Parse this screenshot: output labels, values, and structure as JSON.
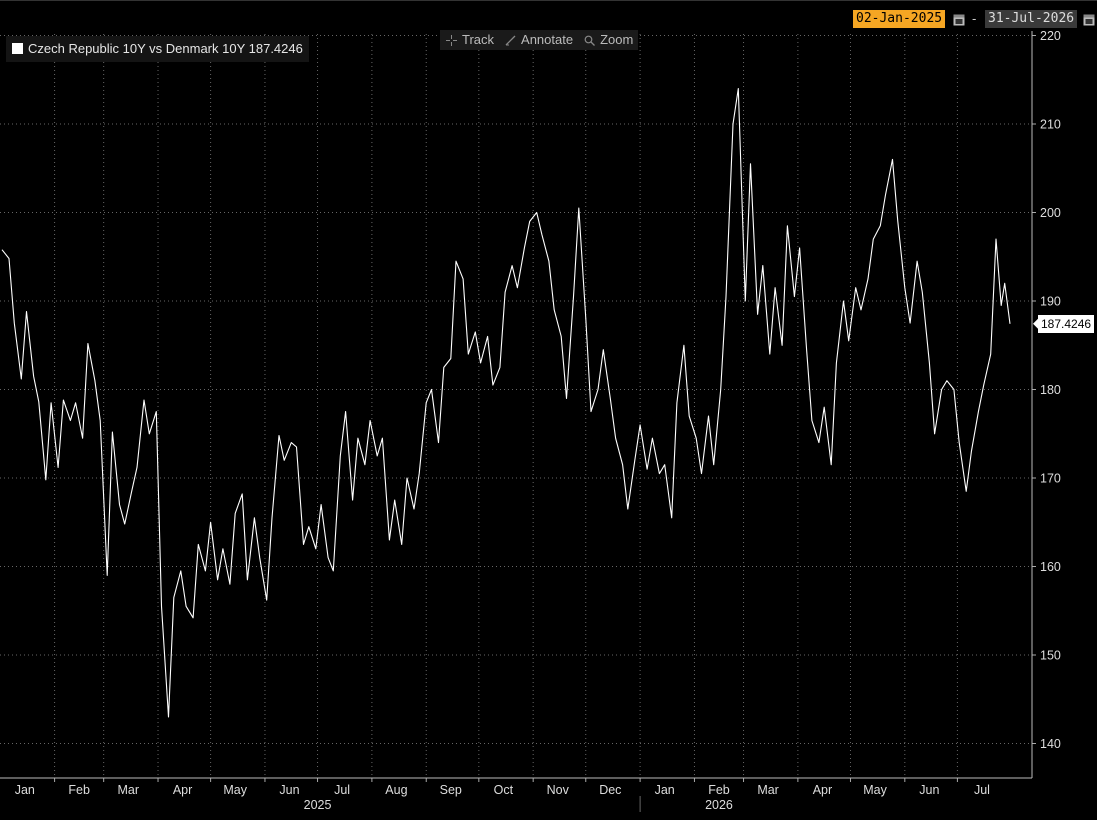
{
  "header": {
    "start_date": "02-Jan-2025",
    "separator": "-",
    "end_date": "31-Jul-2026",
    "calendar_icon": "calendar-icon"
  },
  "toolbar": {
    "track_label": "Track",
    "annotate_label": "Annotate",
    "zoom_label": "Zoom",
    "track_icon": "crosshair-icon",
    "annotate_icon": "pencil-icon",
    "zoom_icon": "magnifier-icon"
  },
  "legend": {
    "text": "Czech Republic 10Y vs Denmark 10Y 187.4246"
  },
  "last_value_label": "187.4246",
  "colors": {
    "background": "#000000",
    "line": "#ffffff",
    "start_date_highlight": "#f5a623",
    "end_date_bg": "#3a3a3a",
    "grid": "#666666"
  },
  "chart_data": {
    "type": "line",
    "series": [
      {
        "name": "Czech Republic 10Y vs Denmark 10Y",
        "points": [
          [
            "2025-01-02",
            195.8
          ],
          [
            "2025-01-06",
            194.8
          ],
          [
            "2025-01-09",
            187.5
          ],
          [
            "2025-01-13",
            181.2
          ],
          [
            "2025-01-16",
            188.8
          ],
          [
            "2025-01-20",
            181.5
          ],
          [
            "2025-01-23",
            178.6
          ],
          [
            "2025-01-27",
            169.8
          ],
          [
            "2025-01-30",
            178.5
          ],
          [
            "2025-02-03",
            171.2
          ],
          [
            "2025-02-06",
            178.8
          ],
          [
            "2025-02-10",
            176.5
          ],
          [
            "2025-02-13",
            178.5
          ],
          [
            "2025-02-17",
            174.5
          ],
          [
            "2025-02-20",
            185.2
          ],
          [
            "2025-02-24",
            181.0
          ],
          [
            "2025-02-27",
            176.5
          ],
          [
            "2025-03-03",
            159.0
          ],
          [
            "2025-03-06",
            175.2
          ],
          [
            "2025-03-10",
            167.0
          ],
          [
            "2025-03-13",
            164.8
          ],
          [
            "2025-03-17",
            168.5
          ],
          [
            "2025-03-20",
            171.2
          ],
          [
            "2025-03-24",
            178.8
          ],
          [
            "2025-03-27",
            175.0
          ],
          [
            "2025-03-31",
            177.5
          ],
          [
            "2025-04-03",
            155.5
          ],
          [
            "2025-04-07",
            143.0
          ],
          [
            "2025-04-10",
            156.5
          ],
          [
            "2025-04-14",
            159.5
          ],
          [
            "2025-04-17",
            155.5
          ],
          [
            "2025-04-21",
            154.2
          ],
          [
            "2025-04-24",
            162.5
          ],
          [
            "2025-04-28",
            159.5
          ],
          [
            "2025-05-01",
            165.0
          ],
          [
            "2025-05-05",
            158.5
          ],
          [
            "2025-05-08",
            162.0
          ],
          [
            "2025-05-12",
            158.0
          ],
          [
            "2025-05-15",
            166.0
          ],
          [
            "2025-05-19",
            168.2
          ],
          [
            "2025-05-22",
            158.5
          ],
          [
            "2025-05-26",
            165.5
          ],
          [
            "2025-05-29",
            161.0
          ],
          [
            "2025-06-02",
            156.2
          ],
          [
            "2025-06-05",
            165.5
          ],
          [
            "2025-06-09",
            174.8
          ],
          [
            "2025-06-12",
            172.0
          ],
          [
            "2025-06-16",
            174.0
          ],
          [
            "2025-06-19",
            173.5
          ],
          [
            "2025-06-23",
            162.5
          ],
          [
            "2025-06-26",
            164.5
          ],
          [
            "2025-06-30",
            162.0
          ],
          [
            "2025-07-03",
            167.0
          ],
          [
            "2025-07-07",
            161.0
          ],
          [
            "2025-07-10",
            159.5
          ],
          [
            "2025-07-14",
            172.5
          ],
          [
            "2025-07-17",
            177.5
          ],
          [
            "2025-07-21",
            167.5
          ],
          [
            "2025-07-24",
            174.5
          ],
          [
            "2025-07-28",
            171.5
          ],
          [
            "2025-07-31",
            176.5
          ],
          [
            "2025-08-04",
            172.5
          ],
          [
            "2025-08-07",
            174.5
          ],
          [
            "2025-08-11",
            163.0
          ],
          [
            "2025-08-14",
            167.5
          ],
          [
            "2025-08-18",
            162.5
          ],
          [
            "2025-08-21",
            170.0
          ],
          [
            "2025-08-25",
            166.5
          ],
          [
            "2025-08-28",
            170.5
          ],
          [
            "2025-09-01",
            178.5
          ],
          [
            "2025-09-04",
            180.0
          ],
          [
            "2025-09-08",
            174.0
          ],
          [
            "2025-09-11",
            182.5
          ],
          [
            "2025-09-15",
            183.5
          ],
          [
            "2025-09-18",
            194.5
          ],
          [
            "2025-09-22",
            192.5
          ],
          [
            "2025-09-25",
            184.0
          ],
          [
            "2025-09-29",
            186.5
          ],
          [
            "2025-10-02",
            183.0
          ],
          [
            "2025-10-06",
            186.0
          ],
          [
            "2025-10-09",
            180.5
          ],
          [
            "2025-10-13",
            182.5
          ],
          [
            "2025-10-16",
            191.0
          ],
          [
            "2025-10-20",
            194.0
          ],
          [
            "2025-10-23",
            191.5
          ],
          [
            "2025-10-27",
            196.0
          ],
          [
            "2025-10-30",
            199.0
          ],
          [
            "2025-11-03",
            200.0
          ],
          [
            "2025-11-06",
            197.5
          ],
          [
            "2025-11-10",
            194.5
          ],
          [
            "2025-11-13",
            189.0
          ],
          [
            "2025-11-17",
            186.0
          ],
          [
            "2025-11-20",
            179.0
          ],
          [
            "2025-11-24",
            190.5
          ],
          [
            "2025-11-27",
            200.5
          ],
          [
            "2025-12-01",
            188.0
          ],
          [
            "2025-12-04",
            177.5
          ],
          [
            "2025-12-08",
            180.0
          ],
          [
            "2025-12-11",
            184.5
          ],
          [
            "2025-12-15",
            179.0
          ],
          [
            "2025-12-18",
            174.5
          ],
          [
            "2025-12-22",
            171.5
          ],
          [
            "2025-12-25",
            166.5
          ],
          [
            "2025-12-29",
            172.0
          ],
          [
            "2026-01-01",
            176.0
          ],
          [
            "2026-01-05",
            171.0
          ],
          [
            "2026-01-08",
            174.5
          ],
          [
            "2026-01-12",
            170.5
          ],
          [
            "2026-01-15",
            171.5
          ],
          [
            "2026-01-19",
            165.5
          ],
          [
            "2026-01-22",
            178.5
          ],
          [
            "2026-01-26",
            185.0
          ],
          [
            "2026-01-29",
            177.0
          ],
          [
            "2026-02-02",
            174.5
          ],
          [
            "2026-02-05",
            170.5
          ],
          [
            "2026-02-09",
            177.0
          ],
          [
            "2026-02-12",
            171.5
          ],
          [
            "2026-02-16",
            180.0
          ],
          [
            "2026-02-19",
            190.5
          ],
          [
            "2026-02-23",
            210.0
          ],
          [
            "2026-02-26",
            214.0
          ],
          [
            "2026-03-02",
            190.0
          ],
          [
            "2026-03-05",
            205.5
          ],
          [
            "2026-03-09",
            188.5
          ],
          [
            "2026-03-12",
            194.0
          ],
          [
            "2026-03-16",
            184.0
          ],
          [
            "2026-03-19",
            191.5
          ],
          [
            "2026-03-23",
            185.0
          ],
          [
            "2026-03-26",
            198.5
          ],
          [
            "2026-03-30",
            190.5
          ],
          [
            "2026-04-02",
            196.0
          ],
          [
            "2026-04-06",
            184.5
          ],
          [
            "2026-04-09",
            176.5
          ],
          [
            "2026-04-13",
            174.0
          ],
          [
            "2026-04-16",
            178.0
          ],
          [
            "2026-04-20",
            171.5
          ],
          [
            "2026-04-23",
            183.0
          ],
          [
            "2026-04-27",
            190.0
          ],
          [
            "2026-04-30",
            185.5
          ],
          [
            "2026-05-04",
            191.5
          ],
          [
            "2026-05-07",
            189.0
          ],
          [
            "2026-05-11",
            192.5
          ],
          [
            "2026-05-14",
            197.0
          ],
          [
            "2026-05-18",
            198.5
          ],
          [
            "2026-05-21",
            202.0
          ],
          [
            "2026-05-25",
            206.0
          ],
          [
            "2026-05-28",
            199.0
          ],
          [
            "2026-06-01",
            191.5
          ],
          [
            "2026-06-04",
            187.5
          ],
          [
            "2026-06-08",
            194.5
          ],
          [
            "2026-06-11",
            191.0
          ],
          [
            "2026-06-15",
            183.0
          ],
          [
            "2026-06-18",
            175.0
          ],
          [
            "2026-06-22",
            180.0
          ],
          [
            "2026-06-25",
            181.0
          ],
          [
            "2026-06-29",
            180.0
          ],
          [
            "2026-07-02",
            174.0
          ],
          [
            "2026-07-06",
            168.5
          ],
          [
            "2026-07-09",
            173.0
          ],
          [
            "2026-07-13",
            177.5
          ],
          [
            "2026-07-16",
            180.5
          ],
          [
            "2026-07-20",
            184.0
          ],
          [
            "2026-07-23",
            197.0
          ],
          [
            "2026-07-26",
            189.5
          ],
          [
            "2026-07-28",
            192.0
          ],
          [
            "2026-07-31",
            187.4246
          ]
        ]
      }
    ],
    "x_axis": {
      "type": "date",
      "range": [
        "2025-01-02",
        "2026-07-31"
      ],
      "month_labels": [
        {
          "date": "2025-01-15",
          "label": "Jan"
        },
        {
          "date": "2025-02-15",
          "label": "Feb"
        },
        {
          "date": "2025-03-15",
          "label": "Mar"
        },
        {
          "date": "2025-04-15",
          "label": "Apr"
        },
        {
          "date": "2025-05-15",
          "label": "May"
        },
        {
          "date": "2025-06-15",
          "label": "Jun"
        },
        {
          "date": "2025-07-15",
          "label": "Jul"
        },
        {
          "date": "2025-08-15",
          "label": "Aug"
        },
        {
          "date": "2025-09-15",
          "label": "Sep"
        },
        {
          "date": "2025-10-15",
          "label": "Oct"
        },
        {
          "date": "2025-11-15",
          "label": "Nov"
        },
        {
          "date": "2025-12-15",
          "label": "Dec"
        },
        {
          "date": "2026-01-15",
          "label": "Jan"
        },
        {
          "date": "2026-02-15",
          "label": "Feb"
        },
        {
          "date": "2026-03-15",
          "label": "Mar"
        },
        {
          "date": "2026-04-15",
          "label": "Apr"
        },
        {
          "date": "2026-05-15",
          "label": "May"
        },
        {
          "date": "2026-06-15",
          "label": "Jun"
        },
        {
          "date": "2026-07-15",
          "label": "Jul"
        }
      ],
      "year_labels": [
        {
          "date": "2025-07-01",
          "label": "2025"
        },
        {
          "date": "2026-02-15",
          "label": "2026"
        }
      ]
    },
    "y_axis": {
      "position": "right",
      "ylim": [
        136,
        222
      ],
      "ticks": [
        140,
        150,
        160,
        170,
        180,
        190,
        200,
        210,
        220
      ]
    },
    "grid": true,
    "legend_position": "top-left",
    "last_value": 187.4246
  }
}
